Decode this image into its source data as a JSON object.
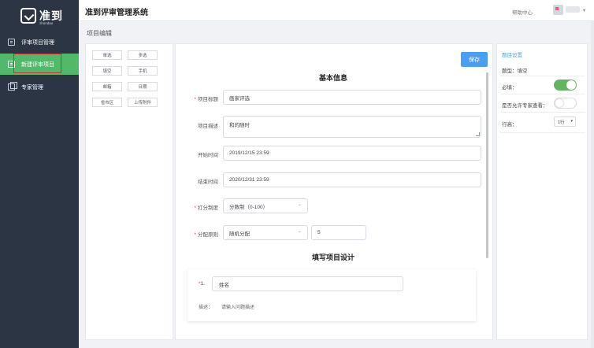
{
  "sidebar": {
    "logo_text": "准到",
    "logo_sub": "zhundao",
    "items": [
      {
        "label": "评审项目管理",
        "icon": "document-icon"
      },
      {
        "label": "新建评审项目",
        "icon": "document-icon"
      },
      {
        "label": "专家管理",
        "icon": "copy-icon"
      }
    ]
  },
  "header": {
    "title": "准到评审管理系统",
    "help": "帮助中心"
  },
  "page_title": "项目编辑",
  "palette": {
    "buttons": [
      "单选",
      "多选",
      "填空",
      "手机",
      "邮箱",
      "日期",
      "省市区",
      "上传附件"
    ]
  },
  "form": {
    "save_label": "保存",
    "section_basic": "基本信息",
    "section_design": "填写项目设计",
    "fields": {
      "title": {
        "label": "项目标题",
        "required": "*",
        "value": "画家评选"
      },
      "desc": {
        "label": "项目描述",
        "value": "和的随时"
      },
      "start": {
        "label": "开始时间",
        "value": "2019/12/15 23:59"
      },
      "end": {
        "label": "结束时间",
        "value": "2020/12/31 23:59"
      },
      "scoring": {
        "label": "打分制度",
        "required": "*",
        "value": "分数制（0-100）"
      },
      "assign": {
        "label": "分配原则",
        "required": "*",
        "value": "随机分配",
        "count": "5"
      }
    },
    "question": {
      "num": "1.",
      "required": "*",
      "value": "姓名",
      "desc_label": "描述：",
      "desc_value": "请输入问题描述"
    }
  },
  "settings": {
    "title": "题目设置",
    "type": "题型：填空",
    "required_label": "必填：",
    "required_on": true,
    "expert_view_label": "是否允许专家查看：",
    "expert_view_on": false,
    "rows_label": "行高：",
    "rows_value": "1行"
  },
  "colors": {
    "sidebar_bg": "#2b3544",
    "active_green": "#52b96a",
    "save_blue": "#4a9ff5",
    "highlight_red": "#d0312d"
  }
}
